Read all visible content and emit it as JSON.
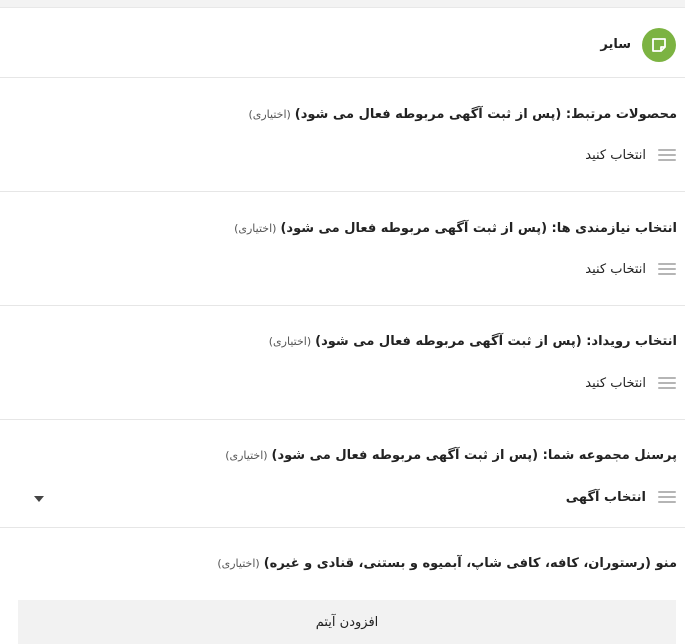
{
  "header": {
    "title": "سایر",
    "icon": "note-icon",
    "icon_color": "#7cb342"
  },
  "sections": [
    {
      "label": "محصولات مرتبط: (پس از ثبت آگهی مربوطه فعال می شود)",
      "optional": "(اختیاری)",
      "select_text": "انتخاب کنید"
    },
    {
      "label": "انتخاب نیازمندی ها: (پس از ثبت آگهی مربوطه فعال می شود)",
      "optional": "(اختیاری)",
      "select_text": "انتخاب کنید"
    },
    {
      "label": "انتخاب رویداد: (پس از ثبت آگهی مربوطه فعال می شود)",
      "optional": "(اختیاری)",
      "select_text": "انتخاب کنید"
    },
    {
      "label": "پرسنل مجموعه شما: (پس از ثبت آگهی مربوطه فعال می شود)",
      "optional": "(اختیاری)",
      "select_text": "انتخاب آگهی"
    }
  ],
  "menu": {
    "label": "منو (رستوران، کافه، کافی شاپ، آبمیوه و بستنی، قنادی و غیره)",
    "optional": "(اختیاری)",
    "add_button": "افزودن آیتم"
  }
}
